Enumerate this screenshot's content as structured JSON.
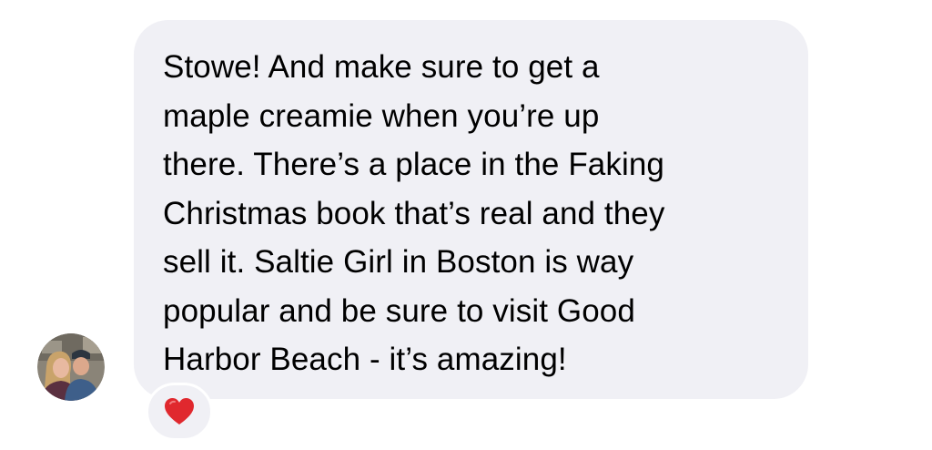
{
  "message": {
    "text": "Stowe! And make sure to get a\nmaple creamie when you’re up\nthere. There’s a place in the Faking\nChristmas book that’s real and they\nsell it. Saltie Girl in Boston is way\npopular and be sure to visit Good\nHarbor Beach - it’s amazing!",
    "bubble_color": "#f0f0f5",
    "text_color": "#000000"
  },
  "sender": {
    "avatar_icon": "profile-photo-two-people"
  },
  "reaction": {
    "icon": "heart-icon",
    "color": "#e0282e"
  }
}
